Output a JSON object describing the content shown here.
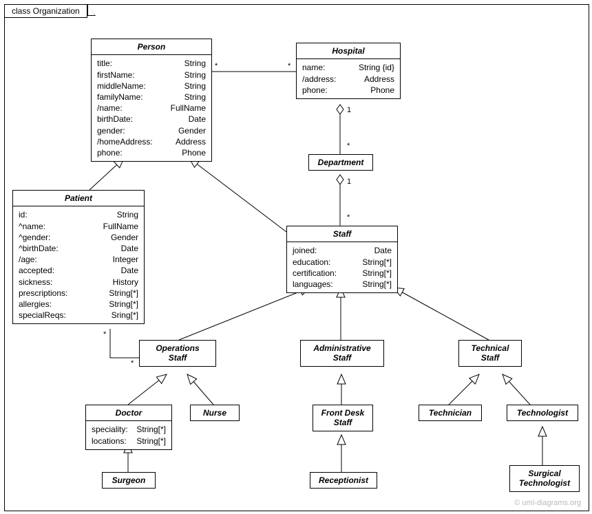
{
  "packageLabel": "class Organization",
  "watermark": "© uml-diagrams.org",
  "classes": {
    "person": {
      "title": "Person",
      "attrs": [
        {
          "n": "title:",
          "t": "String"
        },
        {
          "n": "firstName:",
          "t": "String"
        },
        {
          "n": "middleName:",
          "t": "String"
        },
        {
          "n": "familyName:",
          "t": "String"
        },
        {
          "n": "/name:",
          "t": "FullName"
        },
        {
          "n": "birthDate:",
          "t": "Date"
        },
        {
          "n": "gender:",
          "t": "Gender"
        },
        {
          "n": "/homeAddress:",
          "t": "Address"
        },
        {
          "n": "phone:",
          "t": "Phone"
        }
      ]
    },
    "hospital": {
      "title": "Hospital",
      "attrs": [
        {
          "n": "name:",
          "t": "String {id}"
        },
        {
          "n": "/address:",
          "t": "Address"
        },
        {
          "n": "phone:",
          "t": "Phone"
        }
      ]
    },
    "department": {
      "title": "Department"
    },
    "patient": {
      "title": "Patient",
      "attrs": [
        {
          "n": "id:",
          "t": "String"
        },
        {
          "n": "^name:",
          "t": "FullName"
        },
        {
          "n": "^gender:",
          "t": "Gender"
        },
        {
          "n": "^birthDate:",
          "t": "Date"
        },
        {
          "n": "/age:",
          "t": "Integer"
        },
        {
          "n": "accepted:",
          "t": "Date"
        },
        {
          "n": "sickness:",
          "t": "History"
        },
        {
          "n": "prescriptions:",
          "t": "String[*]"
        },
        {
          "n": "allergies:",
          "t": "String[*]"
        },
        {
          "n": "specialReqs:",
          "t": "Sring[*]"
        }
      ]
    },
    "staff": {
      "title": "Staff",
      "attrs": [
        {
          "n": "joined:",
          "t": "Date"
        },
        {
          "n": "education:",
          "t": "String[*]"
        },
        {
          "n": "certification:",
          "t": "String[*]"
        },
        {
          "n": "languages:",
          "t": "String[*]"
        }
      ]
    },
    "opsStaff": {
      "title": "Operations\nStaff"
    },
    "adminStaff": {
      "title": "Administrative\nStaff"
    },
    "techStaff": {
      "title": "Technical\nStaff"
    },
    "doctor": {
      "title": "Doctor",
      "attrs": [
        {
          "n": "speciality:",
          "t": "String[*]"
        },
        {
          "n": "locations:",
          "t": "String[*]"
        }
      ]
    },
    "nurse": {
      "title": "Nurse"
    },
    "frontDesk": {
      "title": "Front Desk\nStaff"
    },
    "technician": {
      "title": "Technician"
    },
    "technologist": {
      "title": "Technologist"
    },
    "surgeon": {
      "title": "Surgeon"
    },
    "receptionist": {
      "title": "Receptionist"
    },
    "surgTech": {
      "title": "Surgical\nTechnologist"
    }
  },
  "mult": {
    "m1": "*",
    "m2": "*",
    "m3": "1",
    "m4": "*",
    "m5": "1",
    "m6": "*",
    "m7": "*",
    "m8": "*"
  }
}
